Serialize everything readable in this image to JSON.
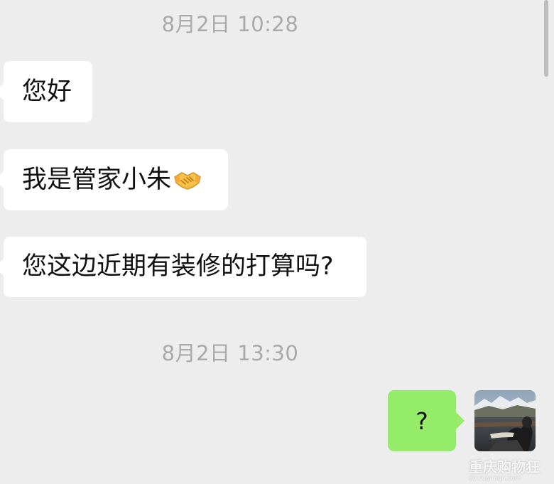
{
  "chat": {
    "timestamps": [
      "8月2日 10:28",
      "8月2日 13:30"
    ],
    "incoming_messages": [
      {
        "text": "您好"
      },
      {
        "text": "我是管家小朱",
        "icon": "handshake-icon"
      },
      {
        "text": "您这边近期有装修的打算吗?"
      }
    ],
    "outgoing_messages": [
      {
        "text": "?"
      }
    ]
  },
  "watermark": {
    "title": "重庆购物狂",
    "url": "go.cqmmgo.com"
  },
  "colors": {
    "background": "#ededed",
    "incoming_bubble": "#ffffff",
    "outgoing_bubble": "#95ec69",
    "timestamp_text": "#a9a9a9"
  }
}
